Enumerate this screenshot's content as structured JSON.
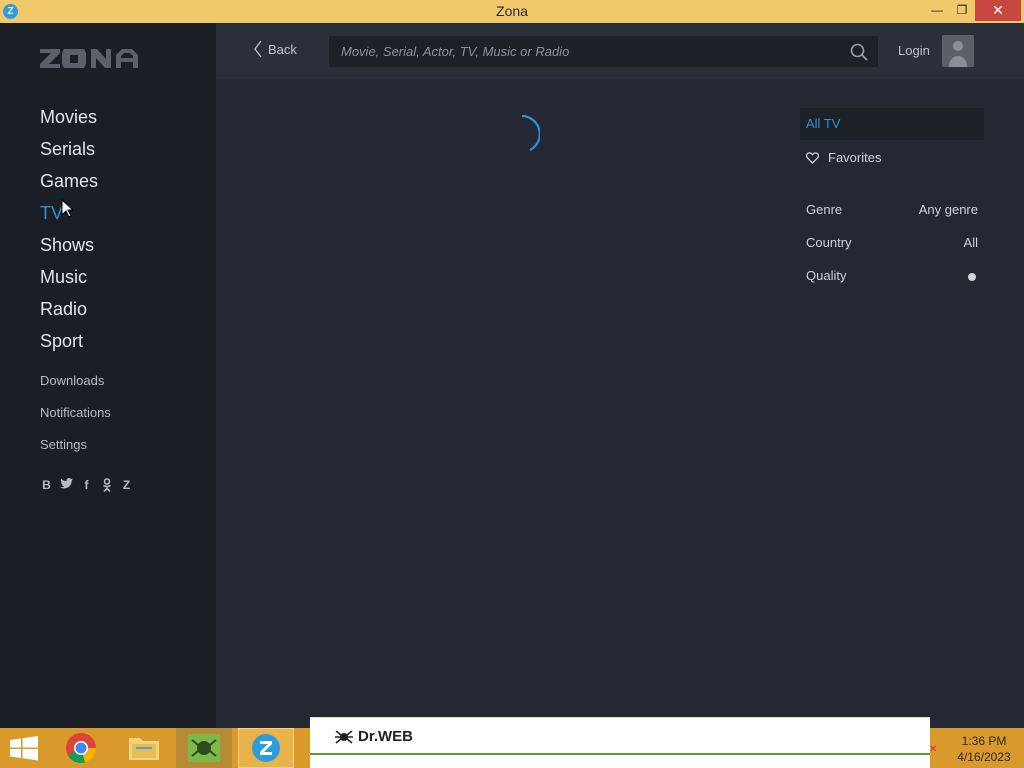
{
  "window": {
    "title": "Zona",
    "app_icon": "Z",
    "min": "—",
    "max": "❐",
    "close": "✕"
  },
  "sidebar": {
    "logo": "zona",
    "main_items": [
      {
        "label": "Movies",
        "active": false
      },
      {
        "label": "Serials",
        "active": false
      },
      {
        "label": "Games",
        "active": false
      },
      {
        "label": "TV",
        "active": true
      },
      {
        "label": "Shows",
        "active": false
      },
      {
        "label": "Music",
        "active": false
      },
      {
        "label": "Radio",
        "active": false
      },
      {
        "label": "Sport",
        "active": false
      }
    ],
    "sub_items": [
      "Downloads",
      "Notifications",
      "Settings"
    ],
    "social": [
      {
        "icon": "vk-icon",
        "glyph": "B"
      },
      {
        "icon": "twitter-icon",
        "glyph": "🐦"
      },
      {
        "icon": "facebook-icon",
        "glyph": "f"
      },
      {
        "icon": "odnoklassniki-icon",
        "glyph": "ꝏ"
      },
      {
        "icon": "zona-icon",
        "glyph": "Z"
      }
    ]
  },
  "topbar": {
    "back_label": "Back",
    "search_placeholder": "Movie, Serial, Actor, TV, Music or Radio",
    "login_label": "Login"
  },
  "filters": {
    "all_tv": "All TV",
    "favorites": "Favorites",
    "genre_label": "Genre",
    "genre_value": "Any genre",
    "country_label": "Country",
    "country_value": "All",
    "quality_label": "Quality"
  },
  "taskbar": {
    "popup_brand": "Dr.WEB",
    "time": "1:36 PM",
    "date": "4/16/2023"
  },
  "colors": {
    "accent": "#2f8fdc",
    "titlebar": "#f1c86a",
    "sidebar": "#1b1e25",
    "content": "#232833",
    "taskbar": "#d99a2b"
  }
}
